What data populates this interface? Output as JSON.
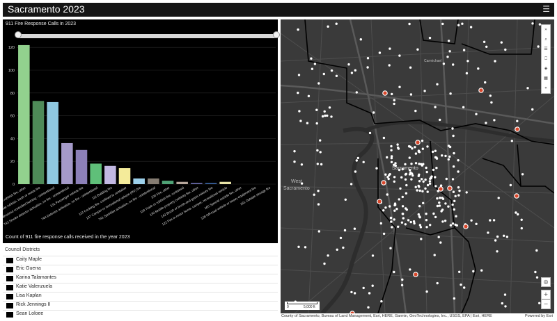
{
  "app": {
    "title": "Sacramento 2023",
    "menu_icon": "hamburger-menu-icon"
  },
  "chart_panel": {
    "title": "911 Fire Response Calls in 2023",
    "footer": "Count of 911 fire response calls received in the year 2023"
  },
  "chart_data": {
    "type": "bar",
    "ylim": [
      0,
      125
    ],
    "yticks": [
      0,
      20,
      40,
      60,
      80,
      100,
      120
    ],
    "grid": true,
    "categories": [
      "154 Outside rubbish fire, other",
      "151 Outside rubbish, trash or waste fire",
      "Authorized controlled burning - unintentional",
      "743 Smoke detector activation, no fire - unintentional",
      "131 Passenger vehicle fire",
      "744 Detector activation, no fire - unintentional",
      "111 Building fire",
      "113 Cooking fire, confined to container",
      "137 Camper or recreational vehicle (RV) fire",
      "741 Sprinkler activation, no fire - unintentional",
      "100 Fire, other",
      "118 Trash or rubbish fire, contained",
      "130 Mobile property (vehicle) fire, other",
      "142 Brush or brush-and-grass mixture fire",
      "122 Fire in motor home, camper, recreational vehicle",
      "160 Special outside fire, other",
      "138 Off-road vehicle or heavy equipment fire",
      "161 Outside storage fire"
    ],
    "values": [
      122,
      73,
      72,
      36,
      30,
      18,
      16,
      14,
      5,
      5,
      3,
      2,
      1,
      1,
      2,
      0,
      0,
      0
    ],
    "colors": [
      "#92d18e",
      "#4e8a58",
      "#8fc8e0",
      "#a59ac9",
      "#8c80b8",
      "#5fbf79",
      "#c2b8e2",
      "#f4eb9a",
      "#9cd0ea",
      "#857c72",
      "#4fa376",
      "#b7a79c",
      "#6c6fb1",
      "#3d67a6",
      "#e8e3a6",
      "#999999",
      "#999999",
      "#999999"
    ]
  },
  "districts": {
    "title": "Council Districts",
    "items": [
      {
        "name": "Caity Maple"
      },
      {
        "name": "Eric Guerra"
      },
      {
        "name": "Karina Talamantes"
      },
      {
        "name": "Katie Valenzuela"
      },
      {
        "name": "Lisa Kaplan"
      },
      {
        "name": "Rick Jennings II"
      },
      {
        "name": "Sean Loloee"
      }
    ]
  },
  "map": {
    "labels": {
      "west_sac_1": "West",
      "west_sac_2": "Sacramento",
      "carmichael": "Carmichael",
      "downtown": "Sacramento"
    },
    "scale": {
      "zero": "0",
      "distance": "5,000 ft"
    },
    "attribution": "County of Sacramento, Bureau of Land Management, Esri, HERE, Garmin, GeoTechnologies, Inc., USGS, EPA | Esri, HERE",
    "powered_by": "Powered by Esri",
    "tools": [
      "expand-icon",
      "search-icon",
      "list-icon",
      "bookmark-icon",
      "layers-icon",
      "basemap-gallery-icon",
      "collapse-icon"
    ],
    "zoom_in": "+",
    "zoom_out": "−",
    "locate_icon": "locate-icon"
  }
}
